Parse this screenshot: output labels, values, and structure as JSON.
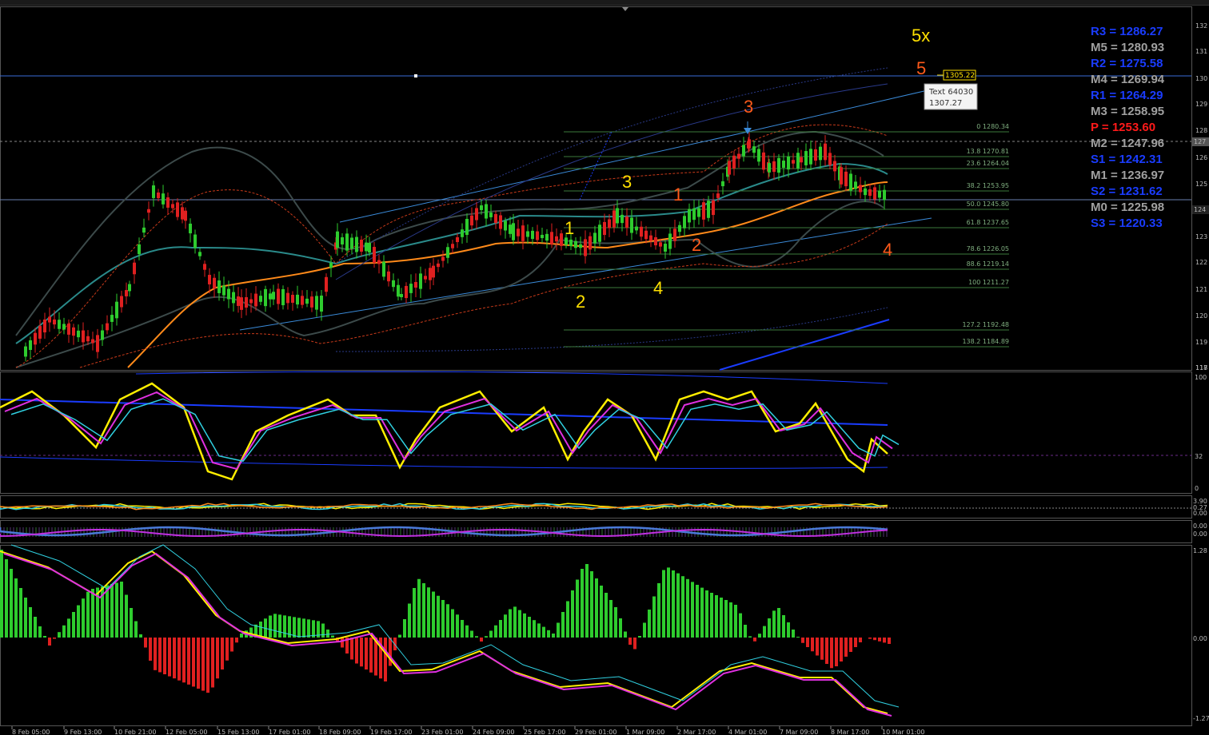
{
  "chart": {
    "price_axis_labels": [
      "132",
      "131",
      "130",
      "129",
      "128",
      "127",
      "126",
      "125",
      "124",
      "123",
      "122",
      "121",
      "120",
      "119",
      "118",
      "117"
    ],
    "last_price_tag": "127",
    "current_price_tag": "124",
    "marker_price": "1305.22",
    "tooltip": {
      "line1": "Text 64030",
      "line2": "1307.27"
    },
    "fib_levels": [
      {
        "label": "0 1280.34"
      },
      {
        "label": "13.8 1270.81"
      },
      {
        "label": "23.6 1264.04"
      },
      {
        "label": "38.2 1253.95"
      },
      {
        "label": "50.0 1245.80"
      },
      {
        "label": "61.8 1237.65"
      },
      {
        "label": "78.6 1226.05"
      },
      {
        "label": "88.6 1219.14"
      },
      {
        "label": "100 1211.27"
      },
      {
        "label": "127.2 1192.48"
      },
      {
        "label": "138.2 1184.89"
      }
    ],
    "waves": [
      {
        "text": "1",
        "color": "#ffe000"
      },
      {
        "text": "2",
        "color": "#ffe000"
      },
      {
        "text": "3",
        "color": "#ffe000"
      },
      {
        "text": "4",
        "color": "#ffe000"
      },
      {
        "text": "5x",
        "color": "#ffe000"
      },
      {
        "text": "1",
        "color": "#ff5a1a"
      },
      {
        "text": "2",
        "color": "#ff5a1a"
      },
      {
        "text": "3",
        "color": "#ff5a1a"
      },
      {
        "text": "4",
        "color": "#ff5a1a"
      },
      {
        "text": "5",
        "color": "#ff5a1a"
      }
    ],
    "pivots": [
      {
        "text": "R3 = 1286.27",
        "color": "#1a3cff"
      },
      {
        "text": "M5 = 1280.93",
        "color": "#a0a0a0"
      },
      {
        "text": "R2 = 1275.58",
        "color": "#1a3cff"
      },
      {
        "text": "M4 = 1269.94",
        "color": "#a0a0a0"
      },
      {
        "text": "R1 = 1264.29",
        "color": "#1a3cff"
      },
      {
        "text": "M3 = 1258.95",
        "color": "#a0a0a0"
      },
      {
        "text": "P   = 1253.60",
        "color": "#ff1a1a"
      },
      {
        "text": "M2 = 1247.96",
        "color": "#a0a0a0"
      },
      {
        "text": "S1 = 1242.31",
        "color": "#1a3cff"
      },
      {
        "text": "M1 = 1236.97",
        "color": "#a0a0a0"
      },
      {
        "text": "S2 = 1231.62",
        "color": "#1a3cff"
      },
      {
        "text": "M0 = 1225.98",
        "color": "#a0a0a0"
      },
      {
        "text": "S3 = 1220.33",
        "color": "#1a3cff"
      }
    ]
  },
  "oscillator1": {
    "labels": [
      "100",
      "32",
      "0"
    ]
  },
  "oscillator2": {
    "labels": [
      "3.90",
      "0.27",
      "0.00"
    ]
  },
  "oscillator3": {
    "labels": [
      "0.00",
      "0.00"
    ]
  },
  "macd": {
    "labels": [
      "1.28",
      "0.00",
      "-1.27"
    ]
  },
  "time_axis": [
    "8 Feb 05:00",
    "9 Feb 13:00",
    "10 Feb 21:00",
    "12 Feb 05:00",
    "15 Feb 13:00",
    "17 Feb 01:00",
    "18 Feb 09:00",
    "19 Feb 17:00",
    "23 Feb 01:00",
    "24 Feb 09:00",
    "25 Feb 17:00",
    "29 Feb 01:00",
    "1 Mar 09:00",
    "2 Mar 17:00",
    "4 Mar 01:00",
    "7 Mar 09:00",
    "8 Mar 17:00",
    "10 Mar 01:00"
  ]
}
